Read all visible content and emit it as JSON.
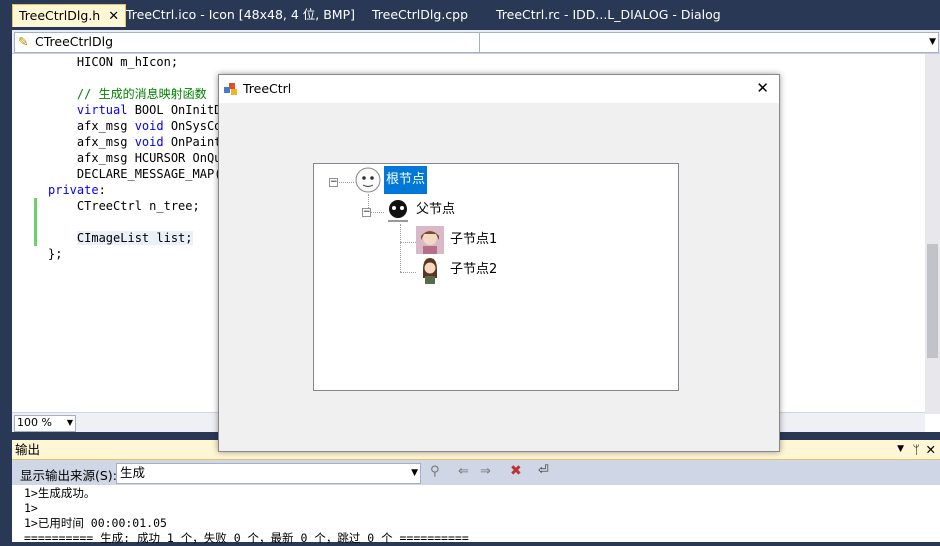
{
  "tabs": [
    {
      "label": "TreeCtrlDlg.h",
      "close": "✕"
    },
    {
      "label": "TreeCtrl.ico - Icon [48x48, 4 位, BMP]"
    },
    {
      "label": "TreeCtrlDlg.cpp"
    },
    {
      "label": "TreeCtrl.rc - IDD...L_DIALOG - Dialog"
    }
  ],
  "editor": {
    "class_combo": "CTreeCtrlDlg",
    "zoom": "100 %",
    "code": [
      {
        "indent": "    ",
        "type": "HICON",
        "rest": " m_hIcon;"
      },
      {
        "indent": "",
        "type": "",
        "rest": ""
      },
      {
        "indent": "    ",
        "comment": "// 生成的消息映射函数"
      },
      {
        "indent": "    ",
        "kw": "virtual",
        "rest": " BOOL OnInitD"
      },
      {
        "indent": "    ",
        "pre": "afx_msg ",
        "kw": "void",
        "rest": " OnSysCo"
      },
      {
        "indent": "    ",
        "pre": "afx_msg ",
        "kw": "void",
        "rest": " OnPaint"
      },
      {
        "indent": "    ",
        "pre": "afx_msg ",
        "rest": "HCURSOR OnQu"
      },
      {
        "indent": "    ",
        "rest": "DECLARE_MESSAGE_MAP("
      },
      {
        "indent": "",
        "kw": "private",
        "rest": ":"
      },
      {
        "indent": "    ",
        "rest": "CTreeCtrl n_tree;"
      },
      {
        "indent": "",
        "rest": ""
      },
      {
        "indent": "    ",
        "rest": "CImageList list;"
      },
      {
        "indent": "",
        "rest": "};"
      }
    ]
  },
  "dialog": {
    "title": "TreeCtrl",
    "close": "✕",
    "tree": {
      "root": "根节点",
      "parent": "父节点",
      "child1": "子节点1",
      "child2": "子节点2"
    }
  },
  "output": {
    "title": "输出",
    "source_label": "显示输出来源(S):",
    "source_value": "生成",
    "lines": [
      "1>生成成功。",
      "1>",
      "1>已用时间 00:00:01.05",
      "========== 生成: 成功 1 个，失败 0 个，最新 0 个，跳过 0 个 =========="
    ]
  }
}
